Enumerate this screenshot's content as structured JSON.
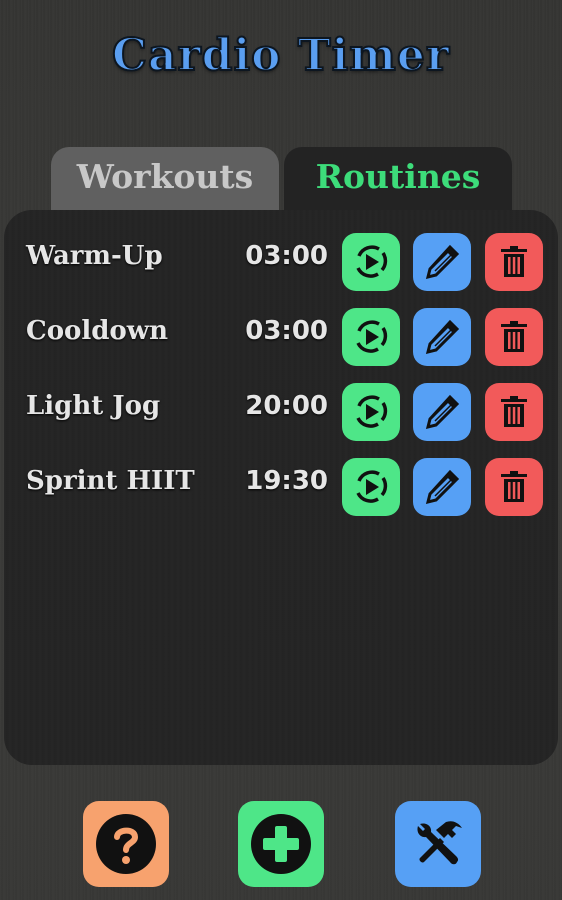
{
  "app": {
    "title": "Cardio Timer"
  },
  "tabs": [
    {
      "label": "Workouts",
      "active": false
    },
    {
      "label": "Routines",
      "active": true
    }
  ],
  "routines": [
    {
      "name": "Warm-Up",
      "duration": "03:00"
    },
    {
      "name": "Cooldown",
      "duration": "03:00"
    },
    {
      "name": "Light Jog",
      "duration": "20:00"
    },
    {
      "name": "Sprint HIIT",
      "duration": "19:30"
    }
  ],
  "row_actions": [
    "play-icon",
    "pencil-icon",
    "trash-icon"
  ],
  "bottom_bar": [
    {
      "icon": "question-icon",
      "action": "help"
    },
    {
      "icon": "plus-circle-icon",
      "action": "add"
    },
    {
      "icon": "tools-icon",
      "action": "settings"
    }
  ],
  "colors": {
    "title": "#5a9ef0",
    "active_tab_text": "#3ddc7a",
    "play": "#4ee688",
    "edit": "#56a0f5",
    "delete": "#f25a5a",
    "help": "#f7a26e"
  }
}
